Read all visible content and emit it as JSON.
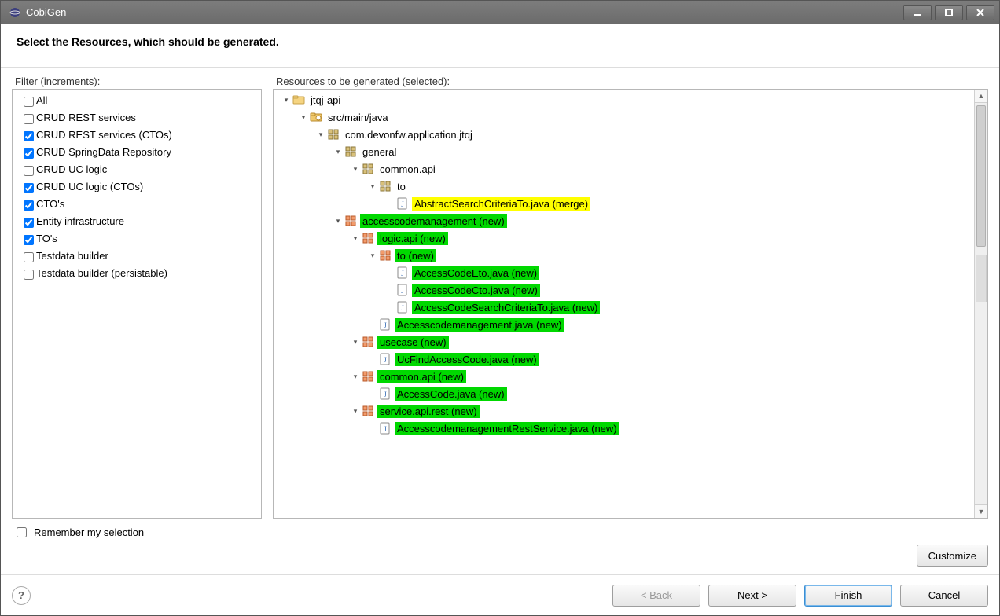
{
  "window": {
    "title": "CobiGen"
  },
  "header": {
    "title": "Select the Resources, which should be generated."
  },
  "filter": {
    "label": "Filter (increments):",
    "items": [
      {
        "label": "All",
        "checked": false
      },
      {
        "label": "CRUD REST services",
        "checked": false
      },
      {
        "label": "CRUD REST services (CTOs)",
        "checked": true
      },
      {
        "label": "CRUD SpringData Repository",
        "checked": true
      },
      {
        "label": "CRUD UC logic",
        "checked": false
      },
      {
        "label": "CRUD UC logic (CTOs)",
        "checked": true
      },
      {
        "label": "CTO's",
        "checked": true
      },
      {
        "label": "Entity infrastructure",
        "checked": true
      },
      {
        "label": "TO's",
        "checked": true
      },
      {
        "label": "Testdata builder",
        "checked": false
      },
      {
        "label": "Testdata builder (persistable)",
        "checked": false
      }
    ]
  },
  "resources": {
    "label": "Resources to be generated (selected):",
    "rows": [
      {
        "indent": 0,
        "expander": "open",
        "icon": "project",
        "label": "jtqj-api",
        "hl": ""
      },
      {
        "indent": 1,
        "expander": "open",
        "icon": "srcfolder",
        "label": "src/main/java",
        "hl": ""
      },
      {
        "indent": 2,
        "expander": "open",
        "icon": "package",
        "label": "com.devonfw.application.jtqj",
        "hl": ""
      },
      {
        "indent": 3,
        "expander": "open",
        "icon": "package",
        "label": "general",
        "hl": ""
      },
      {
        "indent": 4,
        "expander": "open",
        "icon": "package",
        "label": "common.api",
        "hl": ""
      },
      {
        "indent": 5,
        "expander": "open",
        "icon": "package",
        "label": "to",
        "hl": ""
      },
      {
        "indent": 6,
        "expander": "none",
        "icon": "java",
        "label": "AbstractSearchCriteriaTo.java (merge)",
        "hl": "yellow"
      },
      {
        "indent": 3,
        "expander": "open",
        "icon": "package-g",
        "label": "accesscodemanagement (new)",
        "hl": "green"
      },
      {
        "indent": 4,
        "expander": "open",
        "icon": "package-g",
        "label": "logic.api (new)",
        "hl": "green"
      },
      {
        "indent": 5,
        "expander": "open",
        "icon": "package-g",
        "label": "to (new)",
        "hl": "green"
      },
      {
        "indent": 6,
        "expander": "none",
        "icon": "java",
        "label": "AccessCodeEto.java (new)",
        "hl": "green"
      },
      {
        "indent": 6,
        "expander": "none",
        "icon": "java",
        "label": "AccessCodeCto.java (new)",
        "hl": "green"
      },
      {
        "indent": 6,
        "expander": "none",
        "icon": "java",
        "label": "AccessCodeSearchCriteriaTo.java (new)",
        "hl": "green"
      },
      {
        "indent": 5,
        "expander": "none",
        "icon": "java",
        "label": "Accesscodemanagement.java (new)",
        "hl": "green"
      },
      {
        "indent": 4,
        "expander": "open",
        "icon": "package-g",
        "label": "usecase (new)",
        "hl": "green"
      },
      {
        "indent": 5,
        "expander": "none",
        "icon": "java",
        "label": "UcFindAccessCode.java (new)",
        "hl": "green"
      },
      {
        "indent": 4,
        "expander": "open",
        "icon": "package-g",
        "label": "common.api (new)",
        "hl": "green"
      },
      {
        "indent": 5,
        "expander": "none",
        "icon": "java",
        "label": "AccessCode.java (new)",
        "hl": "green"
      },
      {
        "indent": 4,
        "expander": "open",
        "icon": "package-g",
        "label": "service.api.rest (new)",
        "hl": "green"
      },
      {
        "indent": 5,
        "expander": "none",
        "icon": "java",
        "label": "AccesscodemanagementRestService.java (new)",
        "hl": "green"
      }
    ]
  },
  "remember": {
    "label": "Remember my selection",
    "checked": false
  },
  "buttons": {
    "customize": "Customize",
    "back": "< Back",
    "next": "Next >",
    "finish": "Finish",
    "cancel": "Cancel"
  }
}
